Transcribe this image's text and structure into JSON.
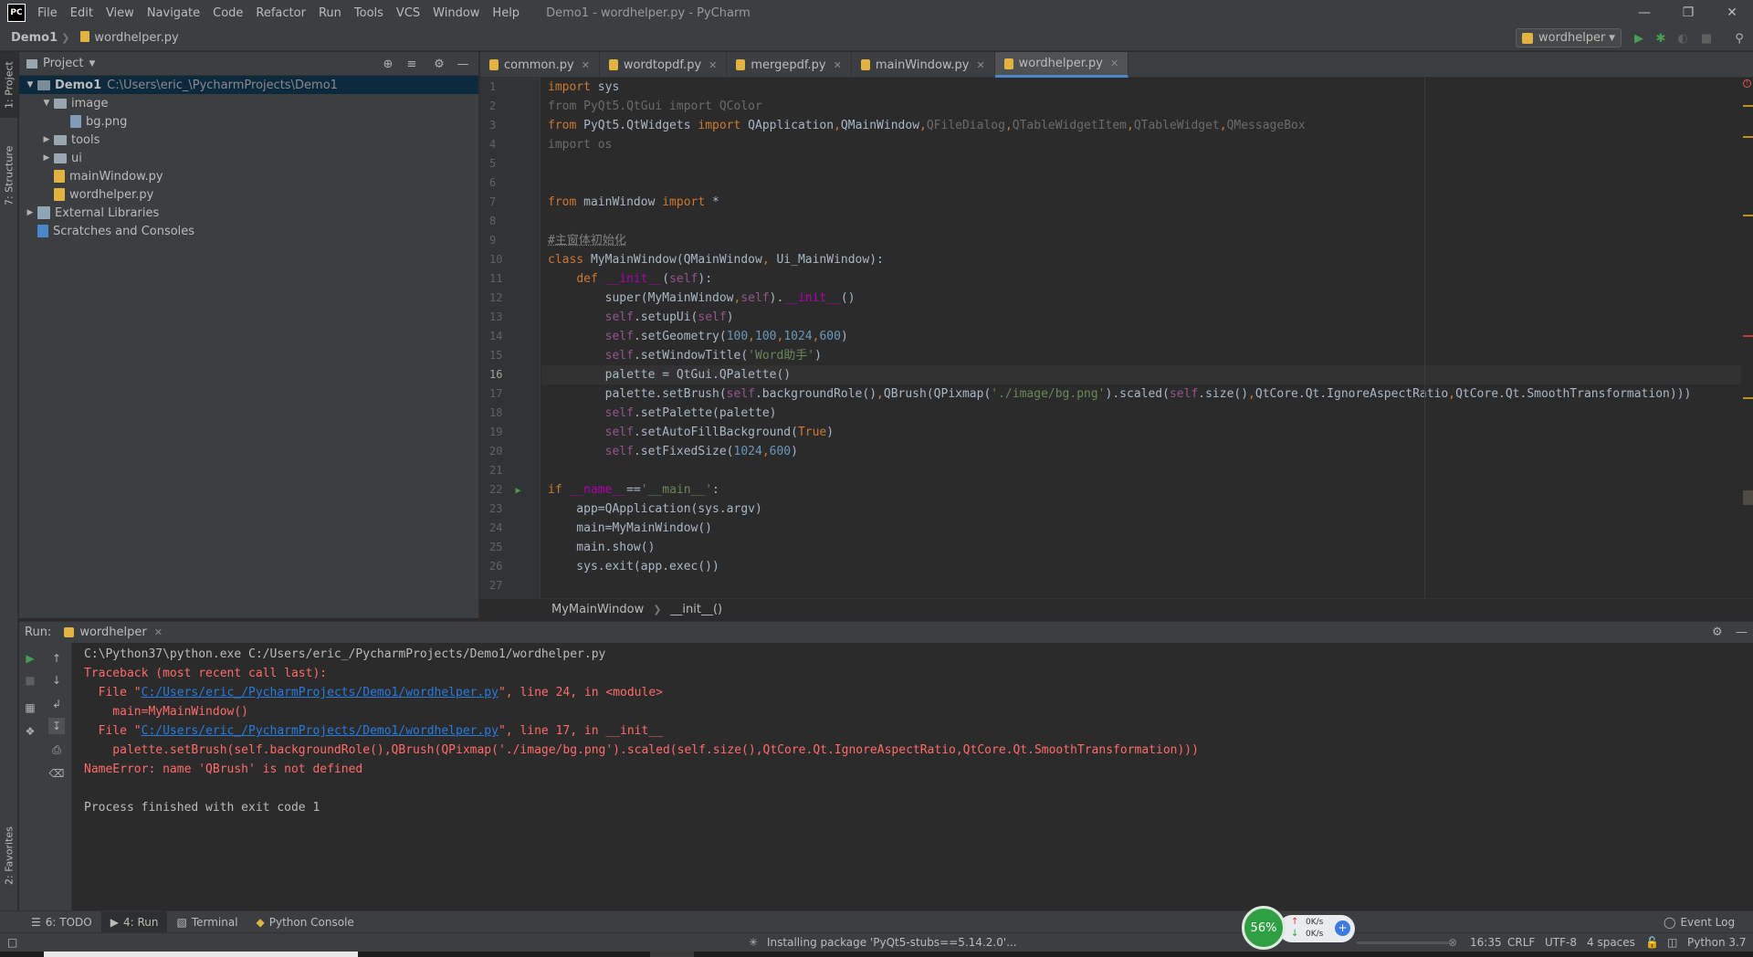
{
  "titlebar": {
    "menu": [
      "File",
      "Edit",
      "View",
      "Navigate",
      "Code",
      "Refactor",
      "Run",
      "Tools",
      "VCS",
      "Window",
      "Help"
    ],
    "window_title": "Demo1 - wordhelper.py - PyCharm",
    "logo_text": "PC"
  },
  "navbar": {
    "project": "Demo1",
    "file": "wordhelper.py",
    "run_config": "wordhelper"
  },
  "left_strip": {
    "project_tab": "1: Project",
    "structure_tab": "7: Structure",
    "favorites_tab": "2: Favorites"
  },
  "project_panel": {
    "title": "Project",
    "tree": [
      {
        "label": "Demo1",
        "hint": "C:\\Users\\eric_\\PycharmProjects\\Demo1",
        "type": "folder",
        "depth": 0,
        "expanded": true,
        "selected": true
      },
      {
        "label": "image",
        "type": "folder",
        "depth": 1,
        "expanded": true
      },
      {
        "label": "bg.png",
        "type": "file",
        "depth": 2
      },
      {
        "label": "tools",
        "type": "folder",
        "depth": 1,
        "expanded": false
      },
      {
        "label": "ui",
        "type": "folder",
        "depth": 1,
        "expanded": false
      },
      {
        "label": "mainWindow.py",
        "type": "py",
        "depth": 1
      },
      {
        "label": "wordhelper.py",
        "type": "py",
        "depth": 1
      },
      {
        "label": "External Libraries",
        "type": "lib",
        "depth": 0,
        "expanded": false
      },
      {
        "label": "Scratches and Consoles",
        "type": "scratch",
        "depth": 0
      }
    ]
  },
  "editor": {
    "tabs": [
      {
        "label": "common.py",
        "active": false
      },
      {
        "label": "wordtopdf.py",
        "active": false
      },
      {
        "label": "mergepdf.py",
        "active": false
      },
      {
        "label": "mainWindow.py",
        "active": false
      },
      {
        "label": "wordhelper.py",
        "active": true
      }
    ],
    "current_line": 16,
    "lines": [
      "import sys",
      "from PyQt5.QtGui import QColor",
      "from PyQt5.QtWidgets import QApplication,QMainWindow,QFileDialog,QTableWidgetItem,QTableWidget,QMessageBox",
      "import os",
      "",
      "",
      "from mainWindow import *",
      "",
      "#主窗体初始化",
      "class MyMainWindow(QMainWindow, Ui_MainWindow):",
      "    def __init__(self):",
      "        super(MyMainWindow,self).__init__()",
      "        self.setupUi(self)",
      "        self.setGeometry(100,100,1024,600)",
      "        self.setWindowTitle('Word助手')",
      "        palette = QtGui.QPalette()",
      "        palette.setBrush(self.backgroundRole(),QBrush(QPixmap('./image/bg.png').scaled(self.size(),QtCore.Qt.IgnoreAspectRatio,QtCore.Qt.SmoothTransformation)))",
      "        self.setPalette(palette)",
      "        self.setAutoFillBackground(True)",
      "        self.setFixedSize(1024,600)",
      "",
      "if __name__=='__main__':",
      "    app=QApplication(sys.argv)",
      "    main=MyMainWindow()",
      "    main.show()",
      "    sys.exit(app.exec())",
      ""
    ],
    "breadcrumb": [
      "MyMainWindow",
      "__init__()"
    ]
  },
  "run_panel": {
    "label": "Run:",
    "tab": "wordhelper",
    "output": [
      {
        "text": "C:\\Python37\\python.exe C:/Users/eric_/PycharmProjects/Demo1/wordhelper.py",
        "kind": "normal"
      },
      {
        "text": "Traceback (most recent call last):",
        "kind": "error"
      },
      {
        "pre": "  File \"",
        "link": "C:/Users/eric_/PycharmProjects/Demo1/wordhelper.py",
        "post": "\", line 24, in <module>",
        "kind": "error"
      },
      {
        "text": "    main=MyMainWindow()",
        "kind": "error"
      },
      {
        "pre": "  File \"",
        "link": "C:/Users/eric_/PycharmProjects/Demo1/wordhelper.py",
        "post": "\", line 17, in __init__",
        "kind": "error"
      },
      {
        "text": "    palette.setBrush(self.backgroundRole(),QBrush(QPixmap('./image/bg.png').scaled(self.size(),QtCore.Qt.IgnoreAspectRatio,QtCore.Qt.SmoothTransformation)))",
        "kind": "error"
      },
      {
        "text": "NameError: name 'QBrush' is not defined",
        "kind": "error"
      },
      {
        "text": "",
        "kind": "normal"
      },
      {
        "text": "Process finished with exit code 1",
        "kind": "normal"
      }
    ]
  },
  "toolwindows": {
    "todo": "6: TODO",
    "run": "4: Run",
    "terminal": "Terminal",
    "python_console": "Python Console",
    "event_log": "Event Log"
  },
  "statusbar": {
    "task": "Installing package 'PyQt5-stubs==5.14.2.0'...",
    "position": "16:35",
    "line_sep": "CRLF",
    "encoding": "UTF-8",
    "indent": "4 spaces",
    "interpreter": "Python 3.7"
  },
  "net_widget": {
    "percent": "56%",
    "up": "0K/s",
    "down": "0K/s"
  },
  "colors": {
    "bg": "#2b2b2b",
    "panel": "#3c3f41",
    "accent": "#4a88c7",
    "error": "#ff6b68",
    "link": "#287bde"
  }
}
